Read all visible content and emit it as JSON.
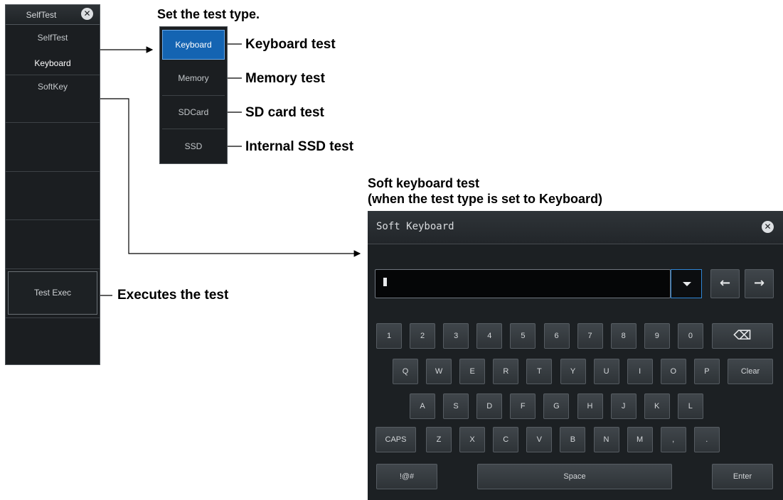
{
  "menu": {
    "title": "SelfTest",
    "selftest_label": "SelfTest",
    "selftest_value": "Keyboard",
    "softkey_label": "SoftKey",
    "exec_label": "Test Exec"
  },
  "test_types": {
    "heading": "Set the test type.",
    "items": [
      "Keyboard",
      "Memory",
      "SDCard",
      "SSD"
    ],
    "selected": "Keyboard",
    "descriptions": [
      "Keyboard test",
      "Memory test",
      "SD card test",
      "Internal SSD test"
    ]
  },
  "annotations": {
    "exec": "Executes the test",
    "softkb_title_1": "Soft keyboard test",
    "softkb_title_2": "(when the test type is set to Keyboard)"
  },
  "keyboard": {
    "title": "Soft Keyboard",
    "input_value": "",
    "row1": [
      "1",
      "2",
      "3",
      "4",
      "5",
      "6",
      "7",
      "8",
      "9",
      "0"
    ],
    "row2": [
      "Q",
      "W",
      "E",
      "R",
      "T",
      "Y",
      "U",
      "I",
      "O",
      "P"
    ],
    "row2_end": "Clear",
    "row3": [
      "A",
      "S",
      "D",
      "F",
      "G",
      "H",
      "J",
      "K",
      "L"
    ],
    "row4_start": "CAPS",
    "row4": [
      "Z",
      "X",
      "C",
      "V",
      "B",
      "N",
      "M",
      ",",
      "."
    ],
    "symbols": "!@#",
    "space": "Space",
    "enter": "Enter",
    "backspace_glyph": "⌫",
    "left_glyph": "←",
    "right_glyph": "→",
    "close_glyph": "✕"
  },
  "colors": {
    "selected": "#1464b2",
    "panel": "#1c2023",
    "focus_border": "#2f86d6"
  }
}
